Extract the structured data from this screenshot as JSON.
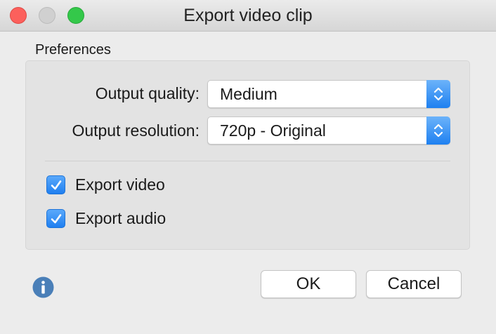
{
  "window": {
    "title": "Export video clip"
  },
  "preferences": {
    "group_label": "Preferences",
    "output_quality": {
      "label": "Output quality:",
      "value": "Medium"
    },
    "output_resolution": {
      "label": "Output resolution:",
      "value": "720p - Original"
    },
    "export_video": {
      "label": "Export video",
      "checked": true
    },
    "export_audio": {
      "label": "Export audio",
      "checked": true
    }
  },
  "footer": {
    "info_icon": "info-icon",
    "ok_label": "OK",
    "cancel_label": "Cancel"
  },
  "colors": {
    "accent": "#1e80f0",
    "close": "#fc605c",
    "zoom": "#34c84a",
    "info": "#4a7fb8"
  }
}
